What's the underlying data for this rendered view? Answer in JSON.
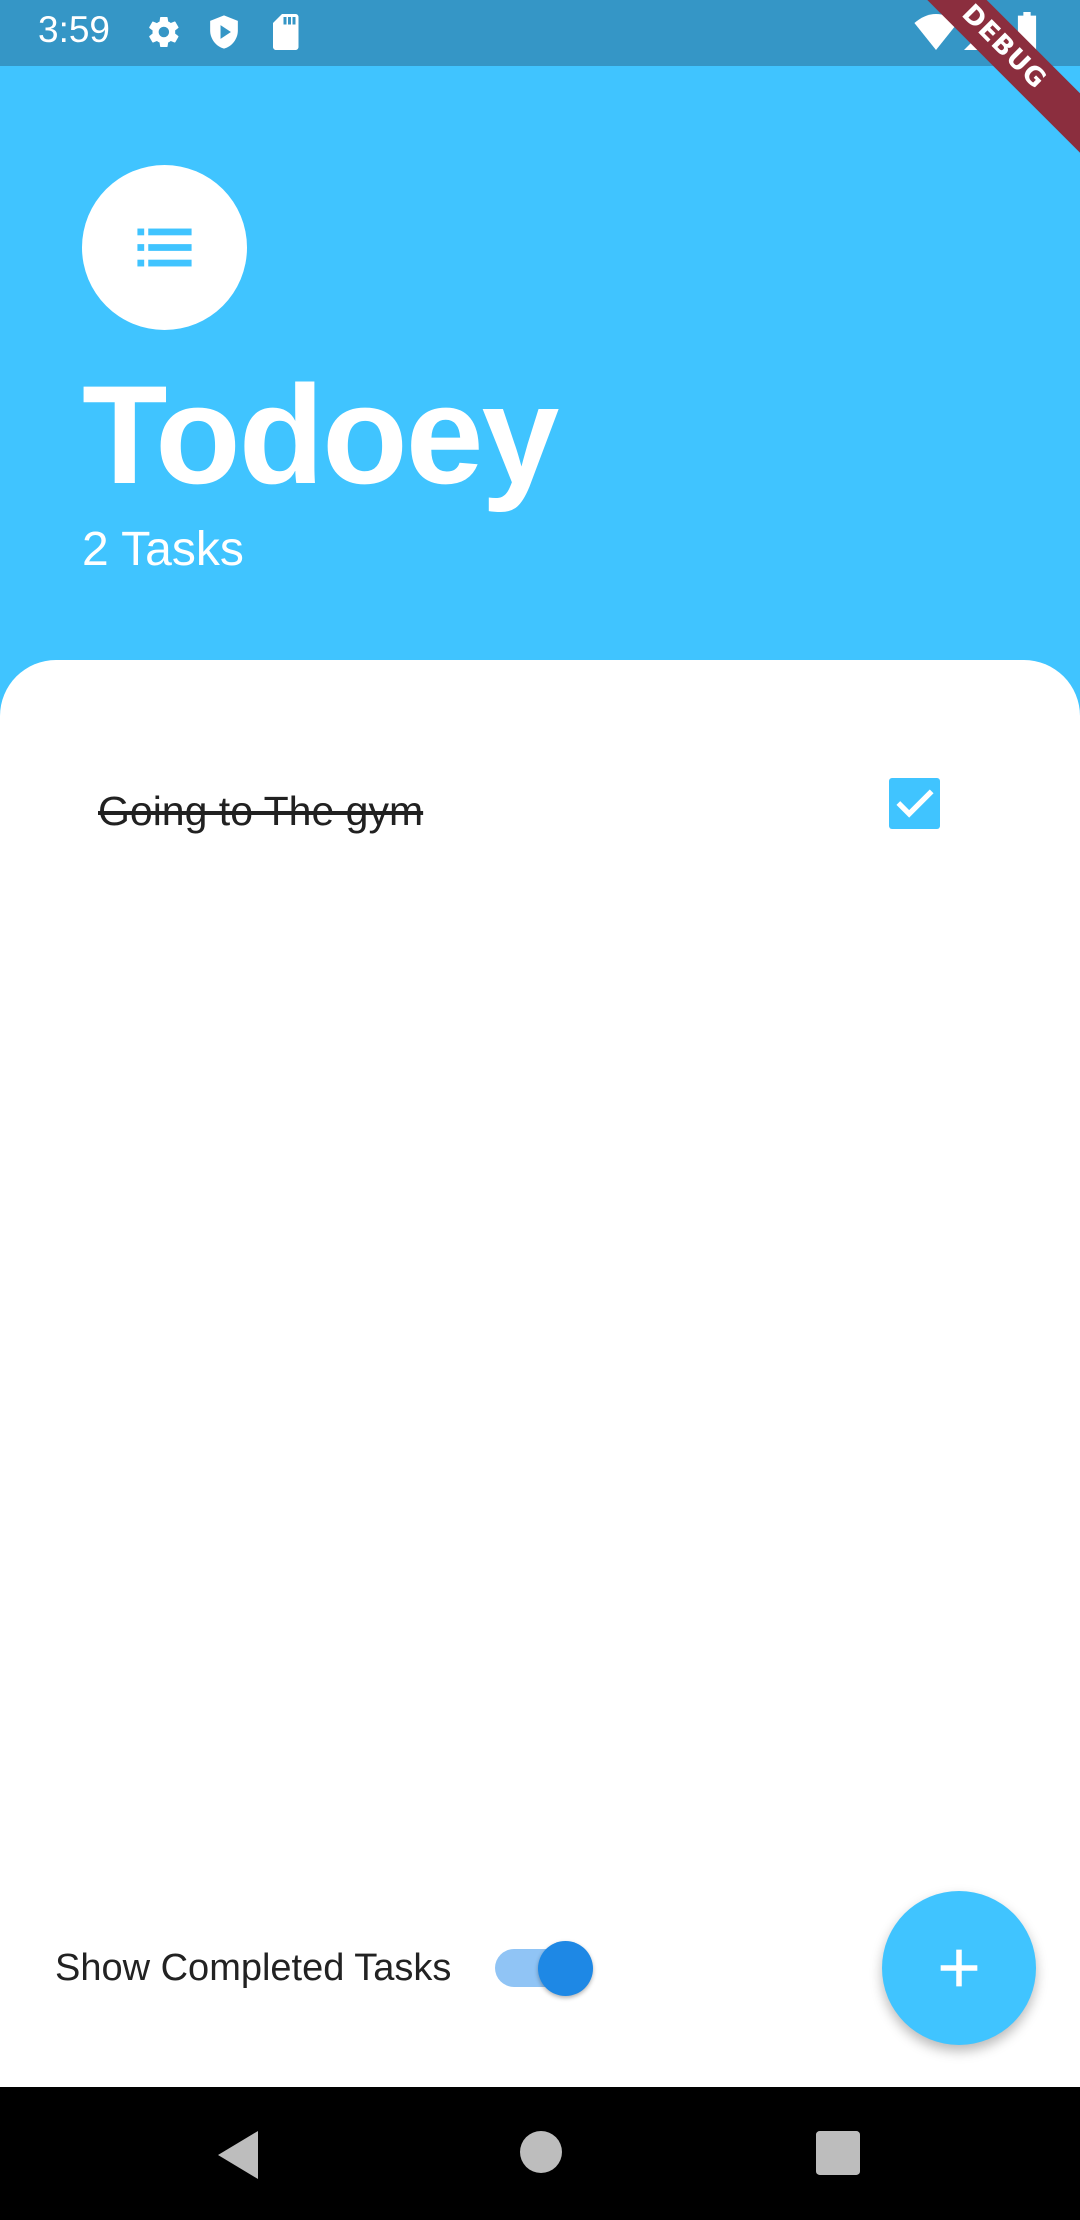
{
  "status_bar": {
    "time": "3:59",
    "icons_left": [
      "gear-icon",
      "play-shield-icon",
      "sd-card-icon"
    ],
    "icons_right": [
      "wifi-icon",
      "signal-icon",
      "battery-icon"
    ],
    "debug_banner": "DEBUG"
  },
  "header": {
    "logo_icon": "list-icon",
    "title": "Todoey",
    "task_count": "2 Tasks"
  },
  "tasks": [
    {
      "label": "Going to The gym",
      "done": true
    }
  ],
  "footer": {
    "show_completed_label": "Show Completed Tasks",
    "show_completed_on": true,
    "add_button_icon": "plus-icon"
  },
  "nav": {
    "icons": [
      "back-icon",
      "home-icon",
      "recents-icon"
    ]
  },
  "colors": {
    "accent": "#40c4ff",
    "status_bar": "#3596c6",
    "toggle_thumb": "#1e88e5",
    "toggle_track": "#90c4f5"
  }
}
